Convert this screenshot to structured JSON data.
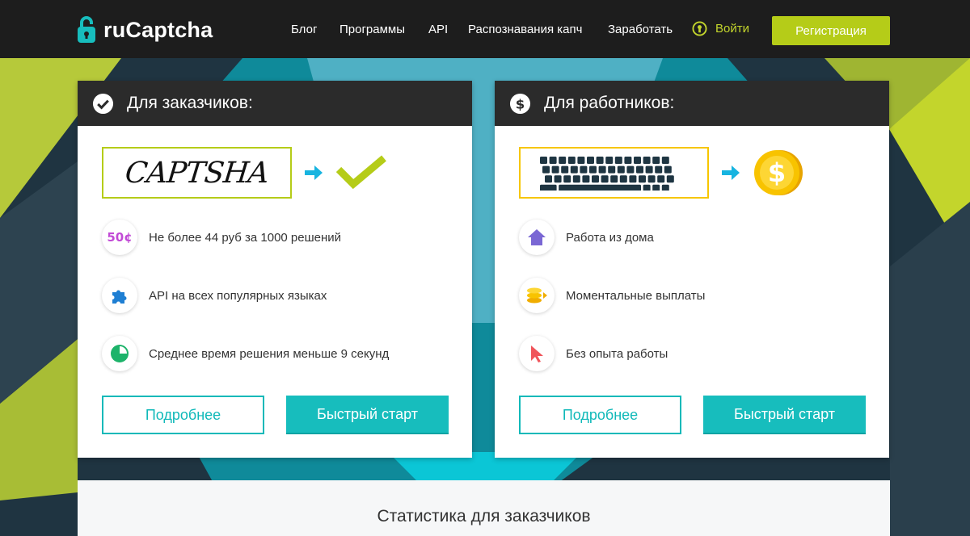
{
  "header": {
    "logo_text": "ruCaptcha",
    "nav": [
      {
        "label": "Блог"
      },
      {
        "label": "Программы"
      },
      {
        "label": "API"
      },
      {
        "label": "Распознавания капч"
      },
      {
        "label": "Заработать"
      }
    ],
    "login_label": "Войти",
    "register_label": "Регистрация"
  },
  "customers": {
    "title": "Для заказчиков:",
    "captcha_sample": "CAPTSHA",
    "features": [
      {
        "icon": "coin-50c-icon",
        "badge": "50¢",
        "text": "Не более 44 руб за 1000 решений"
      },
      {
        "icon": "puzzle-icon",
        "text": "API на всех популярных языках"
      },
      {
        "icon": "timer-icon",
        "text": "Среднее время решения меньше 9 секунд"
      }
    ],
    "more_label": "Подробнее",
    "start_label": "Быстрый старт"
  },
  "workers": {
    "title": "Для работников:",
    "features": [
      {
        "icon": "house-icon",
        "text": "Работа из дома"
      },
      {
        "icon": "coins-stack-icon",
        "text": "Моментальные выплаты"
      },
      {
        "icon": "cursor-icon",
        "text": "Без опыта работы"
      }
    ],
    "more_label": "Подробнее",
    "start_label": "Быстрый старт"
  },
  "stats": {
    "title": "Статистика для заказчиков"
  },
  "colors": {
    "accent_green": "#b5cc18",
    "accent_teal": "#17bdbd",
    "header_bg": "#1d1d1d",
    "card_head_bg": "#2b2b2b"
  }
}
